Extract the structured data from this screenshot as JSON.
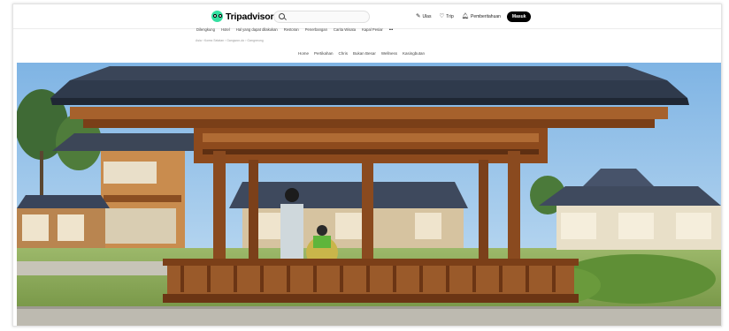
{
  "brand": {
    "name": "Tripadvisor",
    "accent": "#34e0a1"
  },
  "search": {
    "placeholder": ""
  },
  "header": {
    "links": [
      {
        "icon": "pencil-icon",
        "label": "Ulas"
      },
      {
        "icon": "heart-icon",
        "label": "Trip"
      },
      {
        "icon": "bell-icon",
        "label": "Pemberitahuan"
      }
    ],
    "signin_label": "Masuk"
  },
  "nav": {
    "items": [
      "Dilengkung",
      "Hotel",
      "Hal yang dapat dilakukan",
      "Restoran",
      "Penerbangan",
      "Carita Wisata",
      "Kapal Pesiar"
    ],
    "more": "•••"
  },
  "breadcrumb": "Asia › Korea Selatan › Gangwon-do › Gangneung",
  "subnav": {
    "items": [
      "Home",
      "Pertikahan",
      "Chris",
      "Bukan Besar",
      "Wellness",
      "Kasingbutan"
    ]
  },
  "hero": {
    "alt": "Traditional Korean hanok pavilion with a couple in hanbok"
  }
}
